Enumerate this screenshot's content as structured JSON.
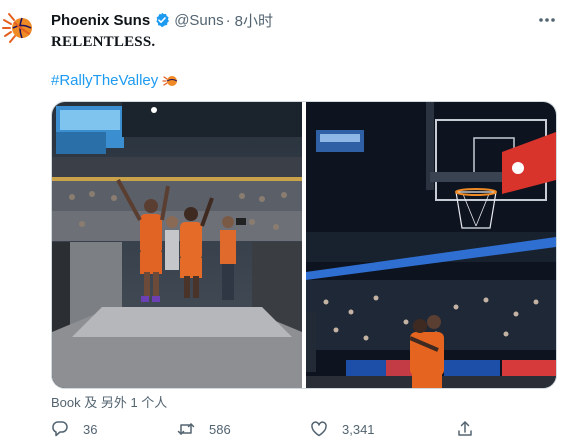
{
  "author": {
    "name": "Phoenix Suns",
    "handle": "@Suns",
    "separator": "·",
    "time": "8小时"
  },
  "tweet": {
    "text": "RELENTLESS.",
    "hashtag": "#RallyTheValley",
    "tagged": "Book 及 另外 1 个人"
  },
  "media": [
    {
      "icon": "arena-photo-players-waving"
    },
    {
      "icon": "arena-photo-players-hugging"
    }
  ],
  "actions": {
    "replies": "36",
    "retweets": "586",
    "likes": "3,341"
  },
  "colors": {
    "accent": "#1d9bf0",
    "secondary_text": "#536471",
    "suns_orange": "#e56020",
    "suns_purple": "#1d1160"
  }
}
